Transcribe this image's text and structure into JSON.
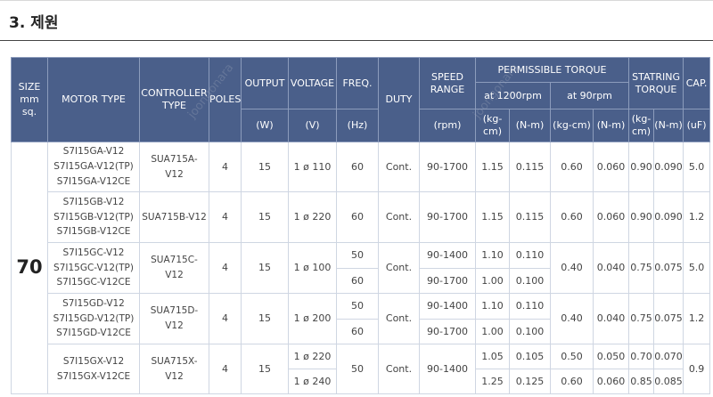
{
  "section": {
    "title": "3. 제원"
  },
  "headers": {
    "size": [
      "SIZE",
      "mm",
      "sq."
    ],
    "motor_type": "MOTOR TYPE",
    "controller_type": [
      "CONTROLLER",
      "TYPE"
    ],
    "poles": "POLES",
    "output": "OUTPUT",
    "voltage": "VOLTAGE",
    "freq": "FREQ.",
    "duty": "DUTY",
    "speed_range": [
      "SPEED",
      "RANGE"
    ],
    "permissible_torque": "PERMISSIBLE TORQUE",
    "at_1200rpm": "at 1200rpm",
    "at_90rpm": "at 90rpm",
    "starting_torque": [
      "STATRING",
      "TORQUE"
    ],
    "cap": "CAP.",
    "units": {
      "output": "(W)",
      "voltage": "(V)",
      "freq": "(Hz)",
      "speed": "(rpm)",
      "t1200_kgcm": [
        "(kg-",
        "cm)"
      ],
      "t1200_nm": "(N-m)",
      "t90_kgcm": "(kg-cm)",
      "t90_nm": "(N-m)",
      "st_kgcm": [
        "(kg-",
        "cm)"
      ],
      "st_nm": "(N-m)",
      "cap": "(uF)"
    }
  },
  "size_value": "70",
  "groups": [
    {
      "models": [
        "S7I15GA-V12",
        "S7I15GA-V12(TP)",
        "S7I15GA-V12CE"
      ],
      "controller": [
        "SUA715A-",
        "V12"
      ],
      "poles": "4",
      "output": "15",
      "duty": "Cont.",
      "t90_kgcm": "0.60",
      "t90_nm": "0.060",
      "st_kgcm": "0.90",
      "st_nm": "0.090",
      "cap": "5.0",
      "rows": [
        {
          "voltage": "1 ø 110",
          "freq": "60",
          "speed": "90-1700",
          "t1200_kgcm": "1.15",
          "t1200_nm": "0.115"
        }
      ]
    },
    {
      "models": [
        "S7I15GB-V12",
        "S7I15GB-V12(TP)",
        "S7I15GB-V12CE"
      ],
      "controller": [
        "SUA715B-V12"
      ],
      "poles": "4",
      "output": "15",
      "duty": "Cont.",
      "t90_kgcm": "0.60",
      "t90_nm": "0.060",
      "st_kgcm": "0.90",
      "st_nm": "0.090",
      "cap": "1.2",
      "rows": [
        {
          "voltage": "1 ø 220",
          "freq": "60",
          "speed": "90-1700",
          "t1200_kgcm": "1.15",
          "t1200_nm": "0.115"
        }
      ]
    },
    {
      "models": [
        "S7I15GC-V12",
        "S7I15GC-V12(TP)",
        "S7I15GC-V12CE"
      ],
      "controller": [
        "SUA715C-",
        "V12"
      ],
      "poles": "4",
      "output": "15",
      "duty": "Cont.",
      "voltage": "1 ø 100",
      "t90_kgcm": "0.40",
      "t90_nm": "0.040",
      "st_kgcm": "0.75",
      "st_nm": "0.075",
      "cap": "5.0",
      "rows": [
        {
          "freq": "50",
          "speed": "90-1400",
          "t1200_kgcm": "1.10",
          "t1200_nm": "0.110"
        },
        {
          "freq": "60",
          "speed": "90-1700",
          "t1200_kgcm": "1.00",
          "t1200_nm": "0.100"
        }
      ]
    },
    {
      "models": [
        "S7I15GD-V12",
        "S7I15GD-V12(TP)",
        "S7I15GD-V12CE"
      ],
      "controller": [
        "SUA715D-",
        "V12"
      ],
      "poles": "4",
      "output": "15",
      "duty": "Cont.",
      "voltage": "1 ø 200",
      "t90_kgcm": "0.40",
      "t90_nm": "0.040",
      "st_kgcm": "0.75",
      "st_nm": "0.075",
      "cap": "1.2",
      "rows": [
        {
          "freq": "50",
          "speed": "90-1400",
          "t1200_kgcm": "1.10",
          "t1200_nm": "0.110"
        },
        {
          "freq": "60",
          "speed": "90-1700",
          "t1200_kgcm": "1.00",
          "t1200_nm": "0.100"
        }
      ]
    },
    {
      "models": [
        "S7I15GX-V12",
        "S7I15GX-V12CE"
      ],
      "controller": [
        "SUA715X-",
        "V12"
      ],
      "poles": "4",
      "output": "15",
      "duty": "Cont.",
      "freq": "50",
      "speed": "90-1400",
      "cap": "0.9",
      "rows": [
        {
          "voltage": "1 ø 220",
          "t1200_kgcm": "1.05",
          "t1200_nm": "0.105",
          "t90_kgcm": "0.50",
          "t90_nm": "0.050",
          "st_kgcm": "0.70",
          "st_nm": "0.070"
        },
        {
          "voltage": "1 ø 240",
          "t1200_kgcm": "1.25",
          "t1200_nm": "0.125",
          "t90_kgcm": "0.60",
          "t90_nm": "0.060",
          "st_kgcm": "0.85",
          "st_nm": "0.085"
        }
      ]
    }
  ],
  "watermark": "joongonara"
}
